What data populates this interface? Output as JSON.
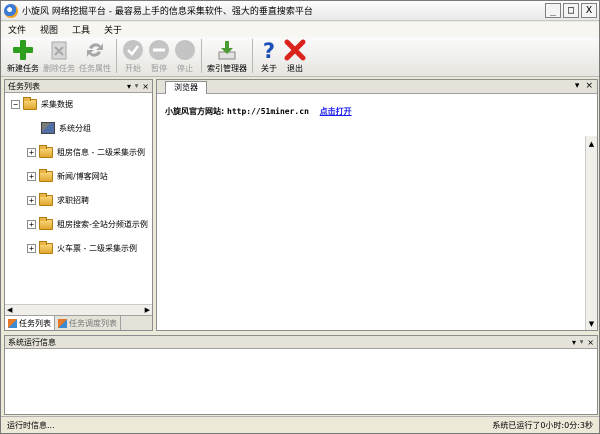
{
  "window": {
    "title": "小旋风 网络挖掘平台 - 最容易上手的信息采集软件、强大的垂直搜索平台",
    "controls": [
      "_",
      "□",
      "X"
    ]
  },
  "menu": [
    "文件",
    "视图",
    "工具",
    "关于"
  ],
  "toolbar": [
    {
      "label": "新建任务",
      "icon": "plus-icon",
      "color": "#2e9e1f",
      "enabled": true
    },
    {
      "label": "删除任务",
      "icon": "delete-icon",
      "color": "#a7a7a7",
      "enabled": false
    },
    {
      "label": "任务属性",
      "icon": "refresh-icon",
      "color": "#a7a7a7",
      "enabled": false
    },
    {
      "label": "开始",
      "icon": "check-circle-icon",
      "color": "#b3b3b3",
      "enabled": false
    },
    {
      "label": "暂停",
      "icon": "minus-circle-icon",
      "color": "#b3b3b3",
      "enabled": false
    },
    {
      "label": "停止",
      "icon": "stop-circle-icon",
      "color": "#b3b3b3",
      "enabled": false
    },
    {
      "label": "索引管理器",
      "icon": "download-icon",
      "color": "#4a9b32",
      "enabled": true
    },
    {
      "label": "关于",
      "icon": "help-icon",
      "color": "#1d4fb8",
      "enabled": true
    },
    {
      "label": "退出",
      "icon": "exit-icon",
      "color": "#d9231b",
      "enabled": true
    }
  ],
  "left_panel": {
    "title": "任务列表",
    "controls": [
      "▾",
      "ᵠ",
      "×"
    ],
    "tree": {
      "root": "采集数据",
      "root_expander": "−",
      "children": [
        {
          "label": "系统分组",
          "icon": "group-icon",
          "expander": ""
        },
        {
          "label": "租房信息 - 二级采集示例",
          "icon": "folder-icon",
          "expander": "+"
        },
        {
          "label": "新闻/博客网站",
          "icon": "folder-icon",
          "expander": "+"
        },
        {
          "label": "求职招聘",
          "icon": "folder-icon",
          "expander": "+"
        },
        {
          "label": "租房搜索-全站分频道示例",
          "icon": "folder-icon",
          "expander": "+"
        },
        {
          "label": "火车票 - 二级采集示例",
          "icon": "folder-icon",
          "expander": "+"
        }
      ]
    },
    "tabs": [
      "任务列表",
      "任务调度列表"
    ]
  },
  "browser": {
    "tab": "浏览器",
    "controls": [
      "▾",
      "×"
    ],
    "info_label": "小旋风官方网站:",
    "url": "http://51miner.cn",
    "link": "点击打开"
  },
  "log_panel": {
    "title": "系统运行信息",
    "controls": [
      "▾",
      "ᵠ",
      "×"
    ]
  },
  "status": {
    "left": "运行时信息...",
    "right": "系统已运行了0小时:0分:3秒"
  }
}
